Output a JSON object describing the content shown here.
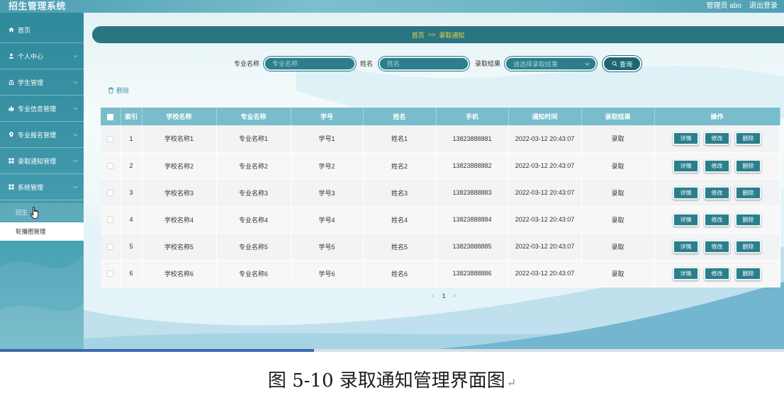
{
  "header": {
    "title": "招生管理系统",
    "user": "管理员 abo",
    "logout": "退出登录"
  },
  "sidebar": {
    "items": [
      {
        "label": "首页",
        "icon": "home-icon"
      },
      {
        "label": "个人中心",
        "icon": "user-icon"
      },
      {
        "label": "学生管理",
        "icon": "bank-icon"
      },
      {
        "label": "专业信息管理",
        "icon": "thumb-up-icon"
      },
      {
        "label": "专业报名管理",
        "icon": "location-icon"
      },
      {
        "label": "录取通知管理",
        "icon": "grid-icon"
      },
      {
        "label": "系统管理",
        "icon": "grid-icon"
      }
    ],
    "sub_items": [
      {
        "label": "回生"
      },
      {
        "label": "轮播图管理"
      }
    ]
  },
  "breadcrumb": {
    "home": "首页",
    "separator": ">>",
    "current": "录取通知"
  },
  "search": {
    "major_label": "专业名称",
    "major_placeholder": "专业名称",
    "name_label": "姓名",
    "name_placeholder": "姓名",
    "result_label": "录取结果",
    "result_placeholder": "请选择录取结果",
    "query_label": "查询"
  },
  "toolbar": {
    "delete_label": "删除"
  },
  "table": {
    "columns": [
      "索引",
      "学校名称",
      "专业名称",
      "学号",
      "姓名",
      "手机",
      "通知时间",
      "录取结果",
      "操作"
    ],
    "rows": [
      {
        "index": "1",
        "school": "学校名称1",
        "major": "专业名称1",
        "student_no": "学号1",
        "name": "姓名1",
        "phone": "13823888881",
        "notice_time": "2022-03-12 20:43:07",
        "result": "录取"
      },
      {
        "index": "2",
        "school": "学校名称2",
        "major": "专业名称2",
        "student_no": "学号2",
        "name": "姓名2",
        "phone": "13823888882",
        "notice_time": "2022-03-12 20:43:07",
        "result": "录取"
      },
      {
        "index": "3",
        "school": "学校名称3",
        "major": "专业名称3",
        "student_no": "学号3",
        "name": "姓名3",
        "phone": "13823888883",
        "notice_time": "2022-03-12 20:43:07",
        "result": "录取"
      },
      {
        "index": "4",
        "school": "学校名称4",
        "major": "专业名称4",
        "student_no": "学号4",
        "name": "姓名4",
        "phone": "13823888884",
        "notice_time": "2022-03-12 20:43:07",
        "result": "录取"
      },
      {
        "index": "5",
        "school": "学校名称5",
        "major": "专业名称5",
        "student_no": "学号5",
        "name": "姓名5",
        "phone": "13823888885",
        "notice_time": "2022-03-12 20:43:07",
        "result": "录取"
      },
      {
        "index": "6",
        "school": "学校名称6",
        "major": "专业名称6",
        "student_no": "学号6",
        "name": "姓名6",
        "phone": "13823888886",
        "notice_time": "2022-03-12 20:43:07",
        "result": "录取"
      }
    ],
    "actions": {
      "detail": "详情",
      "edit": "修改",
      "delete": "删除"
    }
  },
  "pagination": {
    "prev": "<",
    "current": "1",
    "next": ">"
  },
  "caption": {
    "text": "图 5-10 录取通知管理界面图",
    "return_mark": "↵"
  },
  "colors": {
    "sidebar": "#3a93a5",
    "primary": "#2b7e8c",
    "breadcrumb_bg": "#2a7582",
    "breadcrumb_text": "#f0cf45",
    "table_header": "#79bdcc",
    "scrollbar_thumb": "#3c69b0"
  }
}
